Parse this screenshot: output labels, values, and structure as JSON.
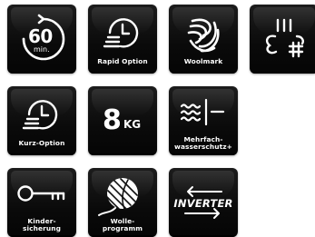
{
  "tiles": {
    "sixty_min": {
      "number": "60",
      "unit": "min."
    },
    "rapid_option": {
      "label": "Rapid Option"
    },
    "woolmark": {
      "label": "Woolmark"
    },
    "steam": {},
    "kurz_option": {
      "label": "Kurz-Option"
    },
    "load_8kg": {
      "number": "8",
      "unit": "KG"
    },
    "mehrfach": {
      "line1": "Mehrfach-",
      "line2": "wasserschutz+"
    },
    "kindersicherung": {
      "line1": "Kinder-",
      "line2": "sicherung"
    },
    "wolle": {
      "line1": "Wolle-",
      "line2": "programm"
    },
    "inverter": {
      "text": "INVERTER"
    }
  }
}
